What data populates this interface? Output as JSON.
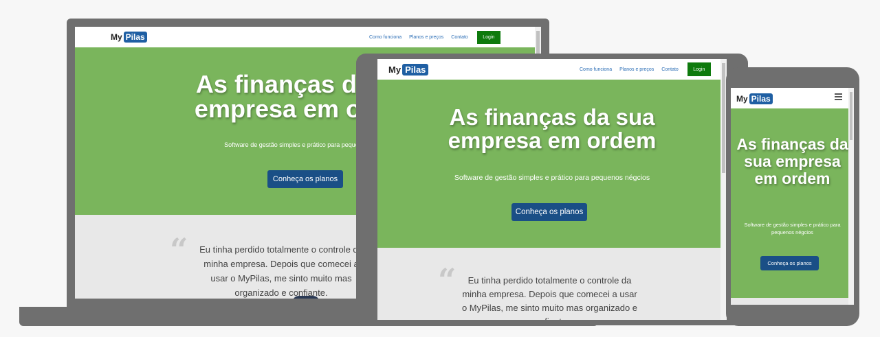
{
  "brand": {
    "logo_my": "My",
    "logo_pilas": "Pilas"
  },
  "nav": {
    "links": [
      "Como funciona",
      "Planos e preços",
      "Contato"
    ],
    "login_label": "Login"
  },
  "hero": {
    "title": "As finanças da sua empresa em ordem",
    "subtitle": "Software de gestão simples e prático para pequenos négcios",
    "cta_label": "Conheça os planos"
  },
  "laptop": {
    "hero_title": "As finanças da sua empresa em ordem",
    "hero_subtitle": "Software de gestão simples e prático para pequenos négcios",
    "quote": "Eu tinha perdido totalmente o controle da minha empresa. Depois que comecei a usar o MyPilas, me sinto muito mas organizado e confiante."
  },
  "tablet": {
    "quote": "Eu tinha perdido totalmente o controle da minha empresa. Depois que comecei a usar o MyPilas, me sinto muito mas organizado e confiante."
  },
  "testimonial": {
    "quote_mark": "“"
  },
  "icons": {
    "menu": "hamburger-menu-icon",
    "quote": "quote-mark-icon"
  },
  "colors": {
    "hero_green": "#7ab55c",
    "login_green": "#0e7a0d",
    "cta_blue": "#1a4f86",
    "link_blue": "#2a6db5",
    "logo_blue": "#1f5fa3",
    "device_gray": "#6f6f6f",
    "testimonial_bg": "#e8e8e8"
  }
}
